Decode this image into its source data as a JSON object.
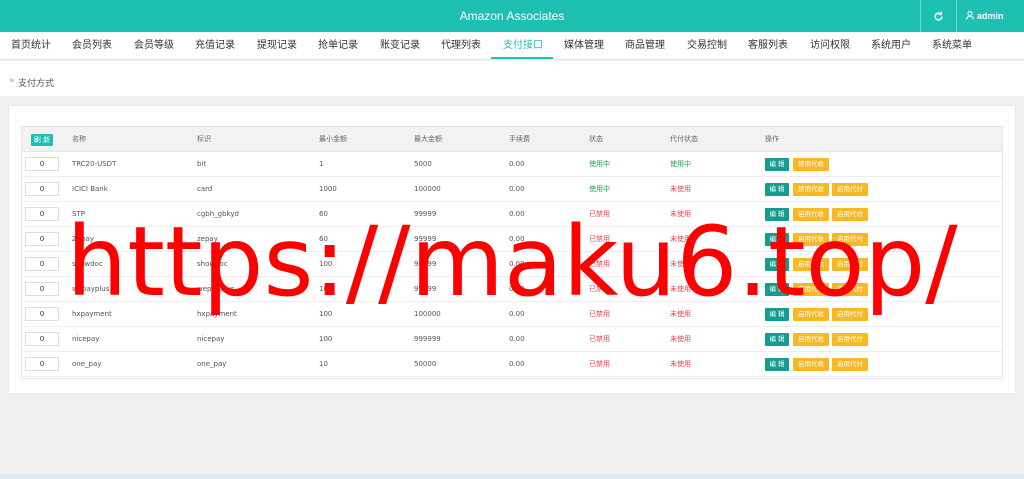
{
  "header": {
    "title": "Amazon Associates",
    "refresh_icon": "refresh-icon",
    "user_icon": "user-icon",
    "username": "admin",
    "color": "#1ec0b1"
  },
  "nav": {
    "items": [
      "首页统计",
      "会员列表",
      "会员等级",
      "充值记录",
      "提现记录",
      "抢单记录",
      "账变记录",
      "代理列表",
      "支付接口",
      "媒体管理",
      "商品管理",
      "交易控制",
      "客服列表",
      "访问权限",
      "系统用户",
      "系统菜单"
    ],
    "active": "支付接口"
  },
  "breadcrumb": {
    "separator": "»",
    "label": "支付方式"
  },
  "table": {
    "refresh_label": "刷 新",
    "headers": [
      "名称",
      "标识",
      "最小金额",
      "最大金额",
      "手续费",
      "状态",
      "代付状态",
      "操作"
    ],
    "rows": [
      {
        "sort": "0",
        "name": "TRC20-USDT",
        "code": "bit",
        "min": "1",
        "max": "5000",
        "fee": "0.00",
        "status": "使用中",
        "payout": "使用中",
        "actions": [
          "编 辑",
          "禁用代收"
        ]
      },
      {
        "sort": "0",
        "name": "ICICI Bank",
        "code": "card",
        "min": "1000",
        "max": "100000",
        "fee": "0.00",
        "status": "使用中",
        "payout": "未使用",
        "actions": [
          "编 辑",
          "禁用代收",
          "启用代付"
        ]
      },
      {
        "sort": "0",
        "name": "STP",
        "code": "cgbh_gbkyd",
        "min": "60",
        "max": "99999",
        "fee": "0.00",
        "status": "已禁用",
        "payout": "未使用",
        "actions": [
          "编 辑",
          "启用代收",
          "启用代付"
        ]
      },
      {
        "sort": "0",
        "name": "Zepay",
        "code": "zepay",
        "min": "60",
        "max": "99999",
        "fee": "0.00",
        "status": "已禁用",
        "payout": "未使用",
        "actions": [
          "编 辑",
          "启用代收",
          "启用代付"
        ]
      },
      {
        "sort": "0",
        "name": "showdoc",
        "code": "showdoc",
        "min": "100",
        "max": "99999",
        "fee": "0.00",
        "status": "已禁用",
        "payout": "未使用",
        "actions": [
          "编 辑",
          "启用代收",
          "启用代付"
        ]
      },
      {
        "sort": "0",
        "name": "wepayplus",
        "code": "wepayplus",
        "min": "100",
        "max": "99999",
        "fee": "0.00",
        "status": "已禁用",
        "payout": "未使用",
        "actions": [
          "编 辑",
          "启用代收",
          "启用代付"
        ]
      },
      {
        "sort": "0",
        "name": "hxpayment",
        "code": "hxpayment",
        "min": "100",
        "max": "100000",
        "fee": "0.00",
        "status": "已禁用",
        "payout": "未使用",
        "actions": [
          "编 辑",
          "启用代收",
          "启用代付"
        ]
      },
      {
        "sort": "0",
        "name": "nicepay",
        "code": "nicepay",
        "min": "100",
        "max": "999999",
        "fee": "0.00",
        "status": "已禁用",
        "payout": "未使用",
        "actions": [
          "编 辑",
          "启用代收",
          "启用代付"
        ]
      },
      {
        "sort": "0",
        "name": "one_pay",
        "code": "one_pay",
        "min": "10",
        "max": "50000",
        "fee": "0.00",
        "status": "已禁用",
        "payout": "未使用",
        "actions": [
          "编 辑",
          "启用代收",
          "启用代付"
        ]
      }
    ]
  },
  "watermark": {
    "text": "https://maku6.top/",
    "color": "#ff0000"
  },
  "colors": {
    "accent": "#1ec0b1",
    "edit": "#169c8f",
    "warn": "#f7b824",
    "green": "#2aa147",
    "red": "#e5484d"
  }
}
